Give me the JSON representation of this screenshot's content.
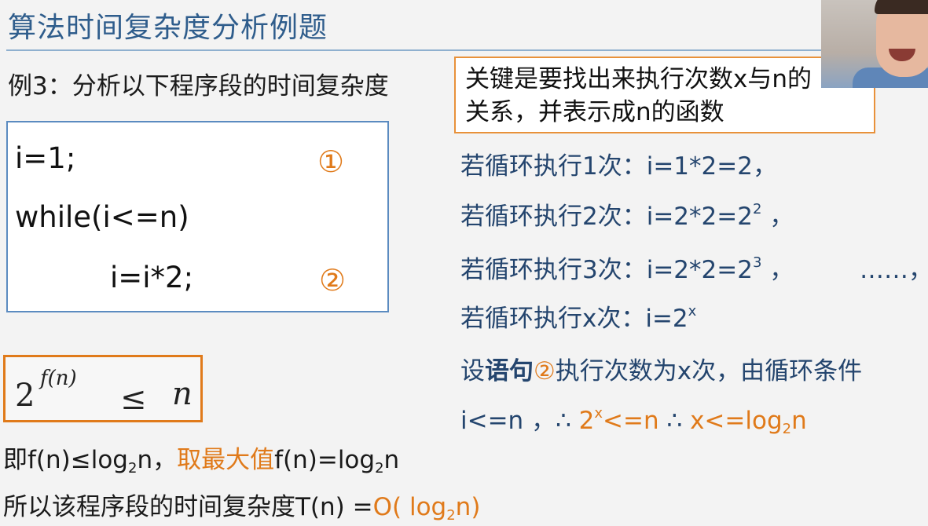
{
  "title": "算法时间复杂度分析例题",
  "example_prompt": "例3：分析以下程序段的时间复杂度",
  "hint": {
    "line1": "关键是要找出来执行次数x与n的",
    "line2": "关系，并表示成n的函数"
  },
  "code": {
    "line1": "i=1;",
    "line2": "while(i<=n)",
    "line3": "i=i*2;",
    "marker1": "①",
    "marker2": "②"
  },
  "steps": {
    "s1": "若循环执行1次：i=1*2=2，",
    "s2_prefix": "若循环执行2次：i=2*2=2",
    "s2_sup": "2",
    "s2_suffix": " ，",
    "s3_prefix": "若循环执行3次：i=2*2=2",
    "s3_sup": "3",
    "s3_suffix": " ，",
    "s3_dots": "……，",
    "s4_prefix": "若循环执行x次：i=2",
    "s4_sup": "x",
    "s5_prefix": "设",
    "s5_bold": "语句",
    "s5_marker": "②",
    "s5_suffix": "执行次数为x次，由循环条件",
    "s6_prefix": "i<=n ，∴ ",
    "s6_o1_a": "2",
    "s6_o1_sup": "x",
    "s6_o1_b": "<=n",
    "s6_mid": "  ∴ ",
    "s6_o2_a": "x<=log",
    "s6_o2_sub": "2",
    "s6_o2_b": "n"
  },
  "formula": {
    "base": "2",
    "exponent": "f(n)",
    "relation": "≤",
    "rhs": "n"
  },
  "conclusion": {
    "l1_a": "即f(n)≤log",
    "l1_sub": "2",
    "l1_b": "n，",
    "l1_orange": "取最大值",
    "l1_c": "f(n)=log",
    "l1_sub2": "2",
    "l1_d": "n",
    "l2_a": "所以该程序段的时间复杂度T(n) =",
    "l2_o_a": "O( log",
    "l2_o_sub": "2",
    "l2_o_b": "n)"
  },
  "colors": {
    "title": "#2f5d8c",
    "accent_orange": "#e07a1a",
    "step_text": "#24456e",
    "code_border": "#5b8bc0",
    "hint_border": "#e8913a"
  }
}
